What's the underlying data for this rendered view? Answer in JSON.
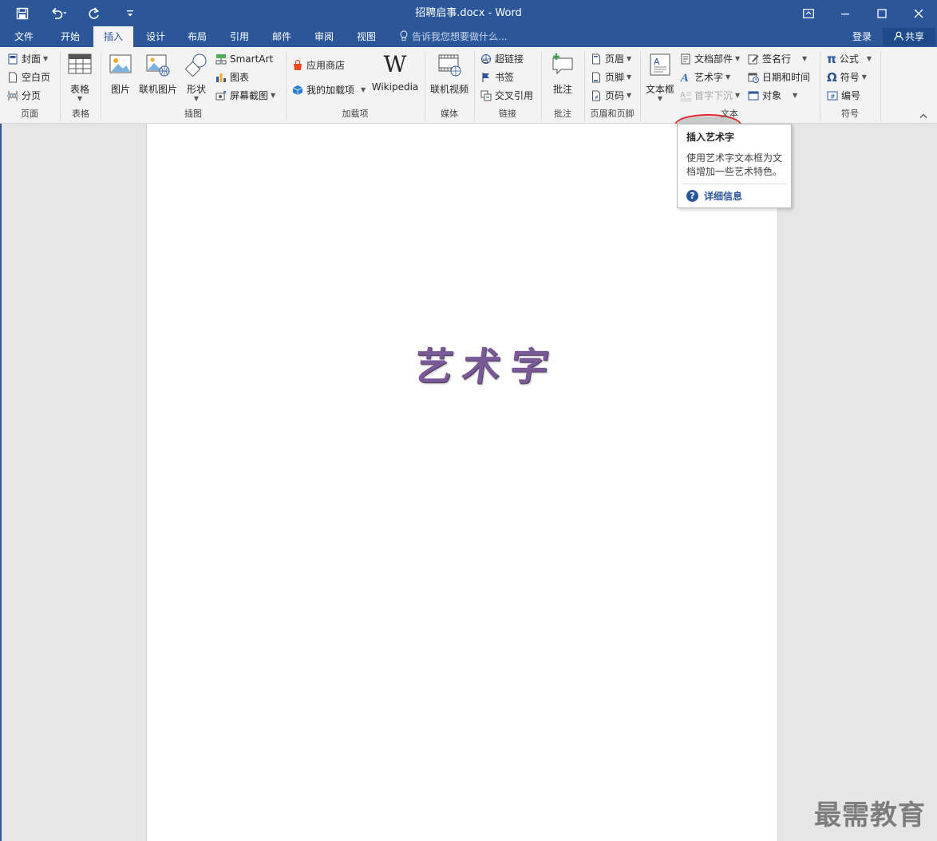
{
  "window": {
    "title": "招聘启事.docx - Word",
    "icons": [
      "save-icon",
      "undo-icon",
      "redo-icon",
      "customize-icon",
      "ribbon-options-icon",
      "minimize-icon",
      "maximize-icon",
      "close-icon"
    ]
  },
  "tabs": {
    "items": [
      "文件",
      "开始",
      "插入",
      "设计",
      "布局",
      "引用",
      "邮件",
      "审阅",
      "视图"
    ],
    "active": "插入",
    "tell_me": "告诉我您想要做什么...",
    "login": "登录",
    "share": "共享"
  },
  "ribbon": {
    "pages": {
      "label": "页面",
      "cover": "封面",
      "blank": "空白页",
      "break": "分页"
    },
    "tables": {
      "label": "表格",
      "table": "表格"
    },
    "illustrations": {
      "label": "插图",
      "picture": "图片",
      "online_picture": "联机图片",
      "shapes": "形状",
      "smartart": "SmartArt",
      "chart": "图表",
      "screenshot": "屏幕截图"
    },
    "addins": {
      "label": "加载项",
      "store": "应用商店",
      "my_addins": "我的加载项",
      "wikipedia": "Wikipedia"
    },
    "media": {
      "label": "媒体",
      "online_video": "联机视频"
    },
    "links": {
      "label": "链接",
      "hyperlink": "超链接",
      "bookmark": "书签",
      "crossref": "交叉引用"
    },
    "comments": {
      "label": "批注",
      "comment": "批注"
    },
    "header_footer": {
      "label": "页眉和页脚",
      "header": "页眉",
      "footer": "页脚",
      "page_number": "页码"
    },
    "text": {
      "label": "文本",
      "textbox": "文本框",
      "quick_parts": "文档部件",
      "wordart": "艺术字",
      "dropcap": "首字下沉",
      "signature": "签名行",
      "datetime": "日期和时间",
      "object": "对象"
    },
    "symbols": {
      "label": "符号",
      "equation": "公式",
      "symbol": "符号",
      "number": "编号",
      "pi": "π",
      "omega": "Ω"
    },
    "wiki_logo": "W"
  },
  "tooltip": {
    "title": "插入艺术字",
    "description": "使用艺术字文本框为文档增加一些艺术特色。",
    "more": "详细信息",
    "q": "?"
  },
  "document": {
    "wordart_text": "艺术字"
  },
  "watermark": "最需教育",
  "colors": {
    "accent": "#2b579a",
    "wordart": "#7a5a96",
    "highlight": "#e2262b"
  }
}
